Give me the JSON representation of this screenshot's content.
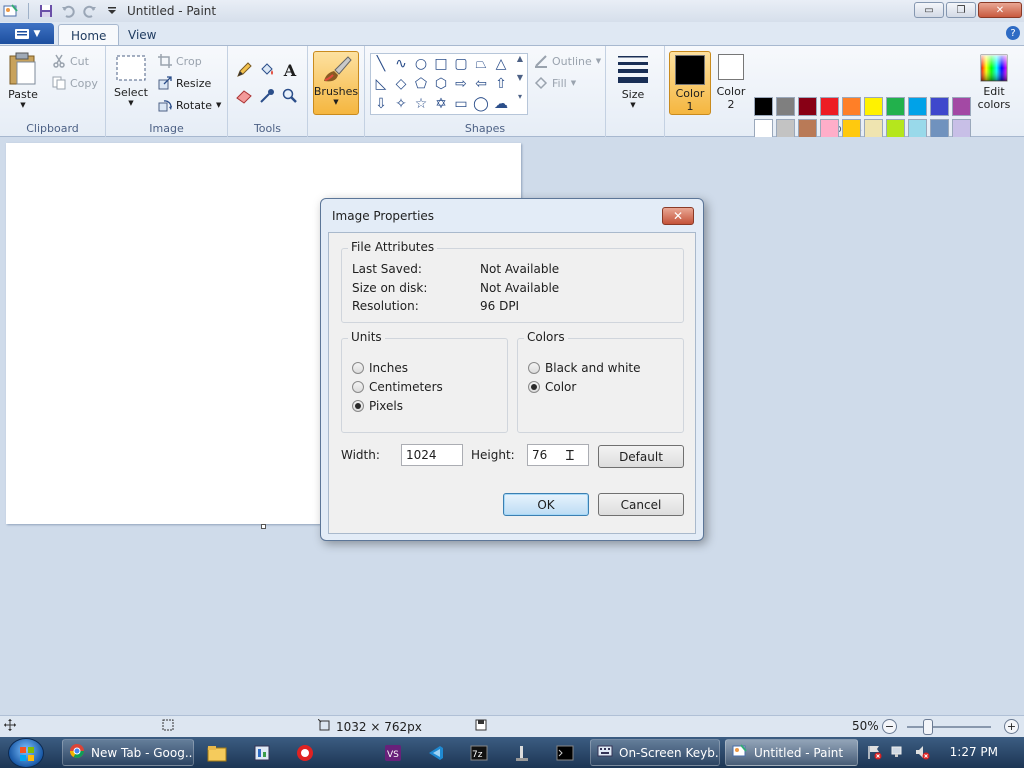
{
  "window": {
    "title": "Untitled - Paint",
    "min_glyph": "▭",
    "restore_glyph": "❐",
    "close_glyph": "✕"
  },
  "tabs": [
    {
      "label": "Home"
    },
    {
      "label": "View"
    }
  ],
  "help_glyph": "?",
  "ribbon": {
    "clipboard": {
      "label": "Clipboard",
      "paste": "Paste",
      "cut": "Cut",
      "copy": "Copy"
    },
    "image": {
      "label": "Image",
      "select": "Select",
      "crop": "Crop",
      "resize": "Resize",
      "rotate": "Rotate"
    },
    "tools": {
      "label": "Tools",
      "text_glyph": "A"
    },
    "brushes": {
      "label": "Brushes"
    },
    "shapes": {
      "label": "Shapes",
      "outline": "Outline",
      "fill": "Fill"
    },
    "size": {
      "label": "Size"
    },
    "colors": {
      "label": "Colors",
      "color1_label": "Color",
      "color1_num": "1",
      "color2_label": "Color",
      "color2_num": "2",
      "color1": "#000000",
      "color2": "#ffffff",
      "edit_label": "Edit",
      "edit_label2": "colors",
      "palette_row1": [
        "#000000",
        "#7f7f7f",
        "#880015",
        "#ed1c24",
        "#ff7f27",
        "#fff200",
        "#22b14c",
        "#00a2e8",
        "#3f48cc",
        "#a349a4"
      ],
      "palette_row2": [
        "#ffffff",
        "#c3c3c3",
        "#b97a57",
        "#ffaec9",
        "#ffc90e",
        "#efe4b0",
        "#b5e61d",
        "#99d9ea",
        "#7092be",
        "#c8bfe7"
      ]
    }
  },
  "dialog": {
    "title": "Image Properties",
    "close_glyph": "✕",
    "file_attributes": {
      "title": "File Attributes",
      "rows": [
        {
          "key": "Last Saved:",
          "value": "Not Available"
        },
        {
          "key": "Size on disk:",
          "value": "Not Available"
        },
        {
          "key": "Resolution:",
          "value": "96 DPI"
        }
      ]
    },
    "units": {
      "title": "Units",
      "options": [
        {
          "label": "Inches",
          "selected": false
        },
        {
          "label": "Centimeters",
          "selected": false
        },
        {
          "label": "Pixels",
          "selected": true
        }
      ]
    },
    "colors": {
      "title": "Colors",
      "options": [
        {
          "label": "Black and white",
          "selected": false
        },
        {
          "label": "Color",
          "selected": true
        }
      ]
    },
    "width_label": "Width:",
    "width_value": "1024",
    "height_label": "Height:",
    "height_value": "76",
    "default_button": "Default",
    "ok_button": "OK",
    "cancel_button": "Cancel"
  },
  "statusbar": {
    "size": "1032 × 762px",
    "zoom": "50%",
    "zoom_out_glyph": "−",
    "zoom_in_glyph": "+"
  },
  "taskbar": {
    "items": [
      {
        "label": "New Tab - Goog..."
      },
      {
        "label": "On-Screen Keyb..."
      },
      {
        "label": "Untitled - Paint"
      }
    ],
    "clock": "1:27 PM"
  }
}
